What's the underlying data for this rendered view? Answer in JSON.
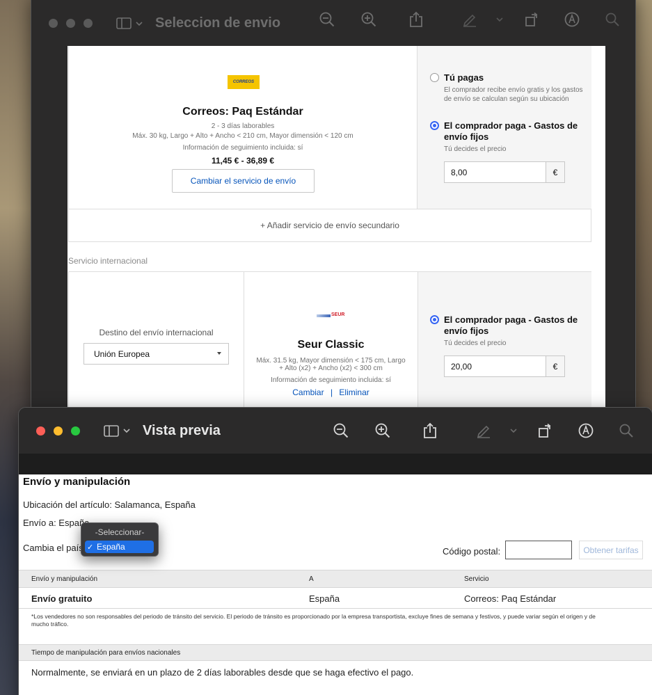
{
  "back_window": {
    "title": "Seleccion de envio",
    "domestic_service": {
      "carrier_logo_text": "CORREOS",
      "name": "Correos: Paq Estándar",
      "line1": "2 - 3 días laborables",
      "line2": "Máx. 30 kg, Largo + Alto + Ancho < 210 cm, Mayor dimensión < 120 cm",
      "line3": "Información de seguimiento incluida: sí",
      "price_range": "11,45 € - 36,89 €",
      "change_button": "Cambiar el servicio de envío"
    },
    "payment_options": {
      "option1_title": "Tú pagas",
      "option1_note_line1": "El comprador recibe envío gratis y los gastos",
      "option1_note_line2": "de envío se calculan según su ubicación",
      "option2_title_line1": "El comprador paga - Gastos de",
      "option2_title_line2": "envío fijos",
      "option2_note": "Tú decides el precio",
      "price_value": "8,00",
      "currency": "€"
    },
    "add_secondary": "+ Añadir servicio de envío secundario",
    "international_label": "Servicio internacional",
    "international": {
      "destination_label": "Destino del envío internacional",
      "destination_value": "Unión Europea",
      "carrier_logo_text": "SEUR",
      "service_name": "Seur Classic",
      "line1": "Máx. 31.5 kg, Mayor dimensión < 175 cm, Largo",
      "line2": "+ Alto (x2) + Ancho (x2) < 300 cm",
      "line3": "Información de seguimiento incluida: sí",
      "change_link": "Cambiar",
      "separator": "|",
      "remove_link": "Eliminar",
      "pay_title_line1": "El comprador paga - Gastos de",
      "pay_title_line2": "envío fijos",
      "pay_note": "Tú decides el precio",
      "price_value": "20,00",
      "currency": "€"
    }
  },
  "front_window": {
    "title": "Vista previa",
    "heading": "Envío y manipulación",
    "item_location": "Ubicación del artículo: Salamanca, España",
    "ship_to": "Envío a: España",
    "change_country_label": "Cambia el país:",
    "postal_code_label": "Código postal:",
    "postal_code_value": "",
    "get_rates_button": "Obtener tarifas",
    "table_headers": [
      "Envío y manipulación",
      "A",
      "Servicio"
    ],
    "table_row": [
      "Envío gratuito",
      "España",
      "Correos: Paq Estándar"
    ],
    "footnote_line1": "*Los vendedores no son responsables del periodo de tránsito del servicio. El periodo de tránsito es proporcionado por la empresa transportista, excluye fines de semana y festivos, y puede variar según el origen y de",
    "footnote_line2": "mucho tráfico.",
    "handling_header": "Tiempo de manipulación para envíos nacionales",
    "handling_text": "Normalmente, se enviará en un plazo de 2 días laborables desde que se haga efectivo el pago.",
    "dropdown": {
      "header": "-Seleccionar-",
      "selected": "España",
      "check": "✓"
    }
  },
  "colors": {
    "accent_blue": "#3665f3",
    "link_blue": "#0654ba",
    "selection_blue": "#1f6fe5"
  }
}
